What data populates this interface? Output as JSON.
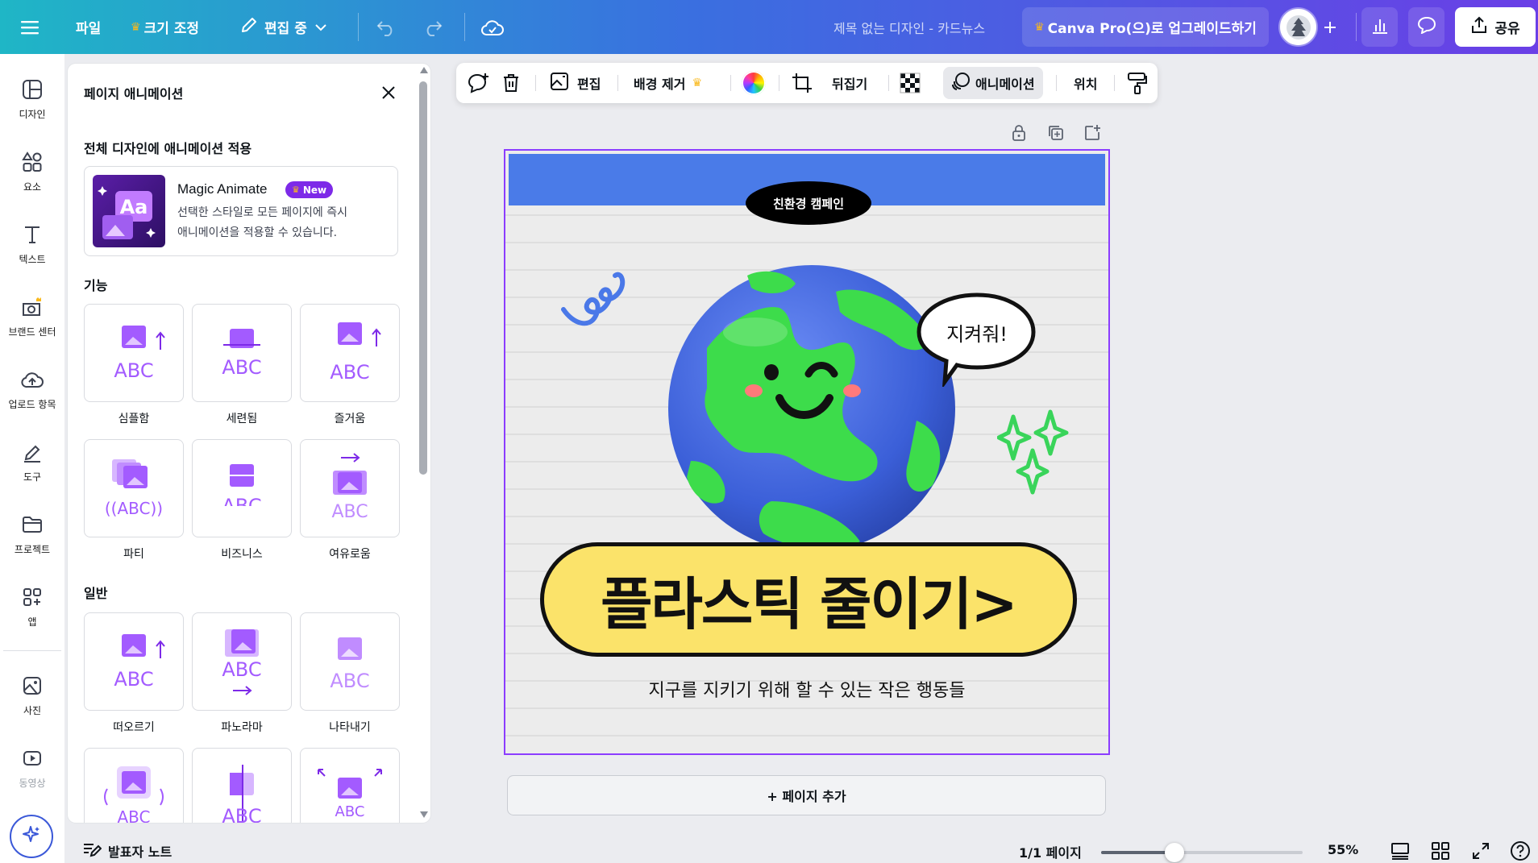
{
  "topbar": {
    "file_label": "파일",
    "resize_label": "크기 조정",
    "editing_label": "편집 중",
    "doc_title": "제목 없는 디자인 - 카드뉴스",
    "upgrade_label": "Canva Pro(으)로 업그레이드하기",
    "share_label": "공유"
  },
  "rail": {
    "items": [
      {
        "label": "디자인",
        "icon": "layout-icon"
      },
      {
        "label": "요소",
        "icon": "shapes-icon"
      },
      {
        "label": "텍스트",
        "icon": "text-icon"
      },
      {
        "label": "브랜드 센터",
        "icon": "brand-icon"
      },
      {
        "label": "업로드 항목",
        "icon": "upload-icon"
      },
      {
        "label": "도구",
        "icon": "pen-icon"
      },
      {
        "label": "프로젝트",
        "icon": "folder-icon"
      },
      {
        "label": "앱",
        "icon": "apps-icon"
      },
      {
        "label": "사진",
        "icon": "photo-icon"
      },
      {
        "label": "동영상",
        "icon": "video-icon"
      }
    ]
  },
  "panel": {
    "title": "페이지 애니메이션",
    "apply_all_heading": "전체 디자인에 애니메이션 적용",
    "magic": {
      "title": "Magic Animate",
      "badge": "New",
      "desc_line1": "선택한 스타일로 모든 페이지에 즉시",
      "desc_line2": "애니메이션을 적용할 수 있습니다."
    },
    "features_heading": "기능",
    "features": [
      "심플함",
      "세련됨",
      "즐거움",
      "파티",
      "비즈니스",
      "여유로움"
    ],
    "general_heading": "일반",
    "general": [
      "떠오르기",
      "파노라마",
      "나타내기"
    ]
  },
  "toolbar": {
    "edit_label": "편집",
    "bg_remove_label": "배경 제거",
    "flip_label": "뒤집기",
    "animate_label": "애니메이션",
    "position_label": "위치"
  },
  "canvas": {
    "tag": "친환경 캠페인",
    "bubble": "지켜줘!",
    "headline": "플라스틱 줄이기>",
    "subline": "지구를 지키기 위해 할 수 있는 작은 행동들",
    "add_page": "+ 페이지 추가"
  },
  "bottom": {
    "notes_label": "발표자 노트",
    "page_counter": "1/1 페이지",
    "zoom": "55%",
    "zoom_level": 0.55
  },
  "colors": {
    "accent": "#8b3dff",
    "canvas_band": "#4a7be8",
    "yellow_button": "#fbe36a",
    "earth_green": "#3ddc4b",
    "earth_blue": "#4a6fe0"
  }
}
